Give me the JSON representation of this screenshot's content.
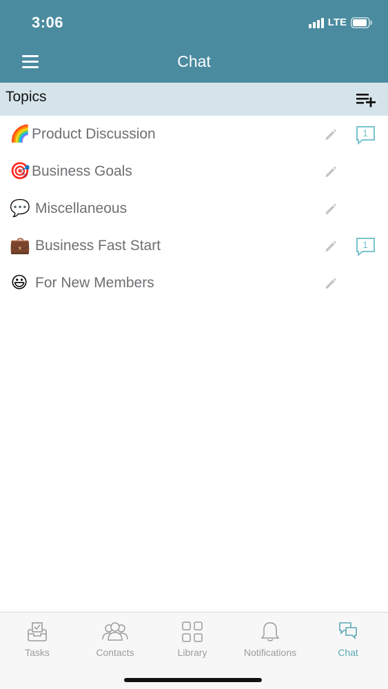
{
  "status_bar": {
    "time": "3:06",
    "network": "LTE"
  },
  "header": {
    "title": "Chat",
    "menu_icon": "hamburger-icon"
  },
  "topics": {
    "title": "Topics",
    "add_icon": "add-list-icon",
    "items": [
      {
        "emoji": "🌈",
        "label": "Product Discussion",
        "badge": "1"
      },
      {
        "emoji": "🎯",
        "label": "Business Goals",
        "badge": ""
      },
      {
        "emoji": "💬",
        "label": "Miscellaneous",
        "badge": ""
      },
      {
        "emoji": "💼",
        "label": "Business Fast Start",
        "badge": "1"
      },
      {
        "emoji": "😃",
        "label": "For New Members",
        "badge": ""
      }
    ]
  },
  "tabbar": {
    "tabs": [
      {
        "label": "Tasks",
        "icon": "tasks-inbox-icon"
      },
      {
        "label": "Contacts",
        "icon": "contacts-group-icon"
      },
      {
        "label": "Library",
        "icon": "library-grid-icon"
      },
      {
        "label": "Notifications",
        "icon": "bell-icon"
      },
      {
        "label": "Chat",
        "icon": "chat-bubbles-icon"
      }
    ],
    "active": "Chat"
  },
  "colors": {
    "header_bg": "#4b8ba0",
    "topics_bar_bg": "#d5e4ea",
    "accent": "#5aa9b5",
    "badge": "#78c3cd"
  }
}
